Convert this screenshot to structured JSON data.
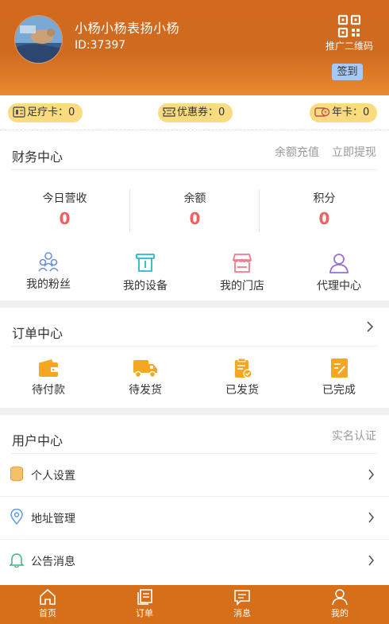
{
  "profile": {
    "name": "小杨小杨表扬小杨",
    "id_text": "ID:37397",
    "qr_label": "推广二维码",
    "signin_label": "签到"
  },
  "cards": [
    {
      "label": "足疗卡：0",
      "icon": "foot-card-icon"
    },
    {
      "label": "优惠券：0",
      "icon": "coupon-icon"
    },
    {
      "label": "年卡：0",
      "icon": "annual-card-icon"
    }
  ],
  "finance": {
    "title": "财务中心",
    "recharge_label": "余额充值",
    "withdraw_label": "立即提现",
    "stats": [
      {
        "label": "今日营收",
        "value": "0"
      },
      {
        "label": "余额",
        "value": "0"
      },
      {
        "label": "积分",
        "value": "0"
      }
    ],
    "grid": [
      {
        "label": "我的粉丝",
        "icon": "fans-icon"
      },
      {
        "label": "我的设备",
        "icon": "device-icon"
      },
      {
        "label": "我的门店",
        "icon": "store-icon"
      },
      {
        "label": "代理中心",
        "icon": "agent-icon"
      }
    ]
  },
  "orders": {
    "title": "订单中心",
    "grid": [
      {
        "label": "待付款",
        "icon": "wallet-icon"
      },
      {
        "label": "待发货",
        "icon": "truck-icon"
      },
      {
        "label": "已发货",
        "icon": "clipboard-check-icon"
      },
      {
        "label": "已完成",
        "icon": "done-note-icon"
      }
    ]
  },
  "user_center": {
    "title": "用户中心",
    "verify_label": "实名认证",
    "rows": [
      {
        "label": "个人设置",
        "icon": "database-icon"
      },
      {
        "label": "地址管理",
        "icon": "location-pin-icon"
      },
      {
        "label": "公告消息",
        "icon": "bell-icon"
      }
    ]
  },
  "tabs": [
    {
      "label": "首页",
      "icon": "home-icon"
    },
    {
      "label": "订单",
      "icon": "orders-icon"
    },
    {
      "label": "消息",
      "icon": "message-icon"
    },
    {
      "label": "我的",
      "icon": "user-icon"
    }
  ],
  "colors": {
    "header": "#d2691e",
    "tabbar": "#d66f1a",
    "pill": "#f9dc80",
    "stat_value": "#f06060",
    "order_icon": "#f5a623"
  }
}
